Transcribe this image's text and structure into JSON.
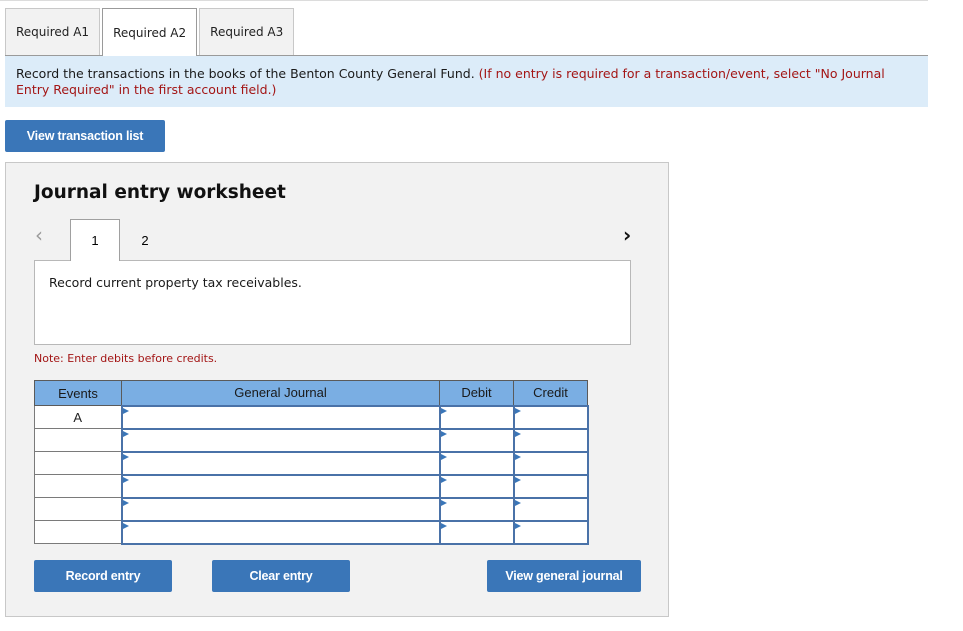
{
  "tabs": [
    {
      "label": "Required A1",
      "active": false
    },
    {
      "label": "Required A2",
      "active": true
    },
    {
      "label": "Required A3",
      "active": false
    }
  ],
  "instruction": {
    "main": "Record the transactions in the books of the Benton County General Fund.",
    "hint": "(If no entry is required for a transaction/event, select \"No Journal Entry Required\" in the first account field.)"
  },
  "buttons": {
    "view_transaction_list": "View transaction list",
    "record_entry": "Record entry",
    "clear_entry": "Clear entry",
    "view_general_journal": "View general journal"
  },
  "worksheet": {
    "title": "Journal entry worksheet",
    "prev_icon": "chevron-left-icon",
    "next_icon": "chevron-right-icon",
    "pages": [
      "1",
      "2"
    ],
    "active_page": "1",
    "description": "Record current property tax receivables.",
    "note": "Note: Enter debits before credits."
  },
  "journal": {
    "headers": {
      "events": "Events",
      "account": "General Journal",
      "debit": "Debit",
      "credit": "Credit"
    },
    "rows": [
      {
        "event": "A",
        "account": "",
        "debit": "",
        "credit": ""
      },
      {
        "event": "",
        "account": "",
        "debit": "",
        "credit": ""
      },
      {
        "event": "",
        "account": "",
        "debit": "",
        "credit": ""
      },
      {
        "event": "",
        "account": "",
        "debit": "",
        "credit": ""
      },
      {
        "event": "",
        "account": "",
        "debit": "",
        "credit": ""
      },
      {
        "event": "",
        "account": "",
        "debit": "",
        "credit": ""
      }
    ]
  },
  "colors": {
    "button_blue": "#3a76b8",
    "header_blue": "#7aaee3",
    "instruction_bg": "#dcecf9",
    "hint_red": "#a31515",
    "panel_bg": "#f2f2f2"
  }
}
